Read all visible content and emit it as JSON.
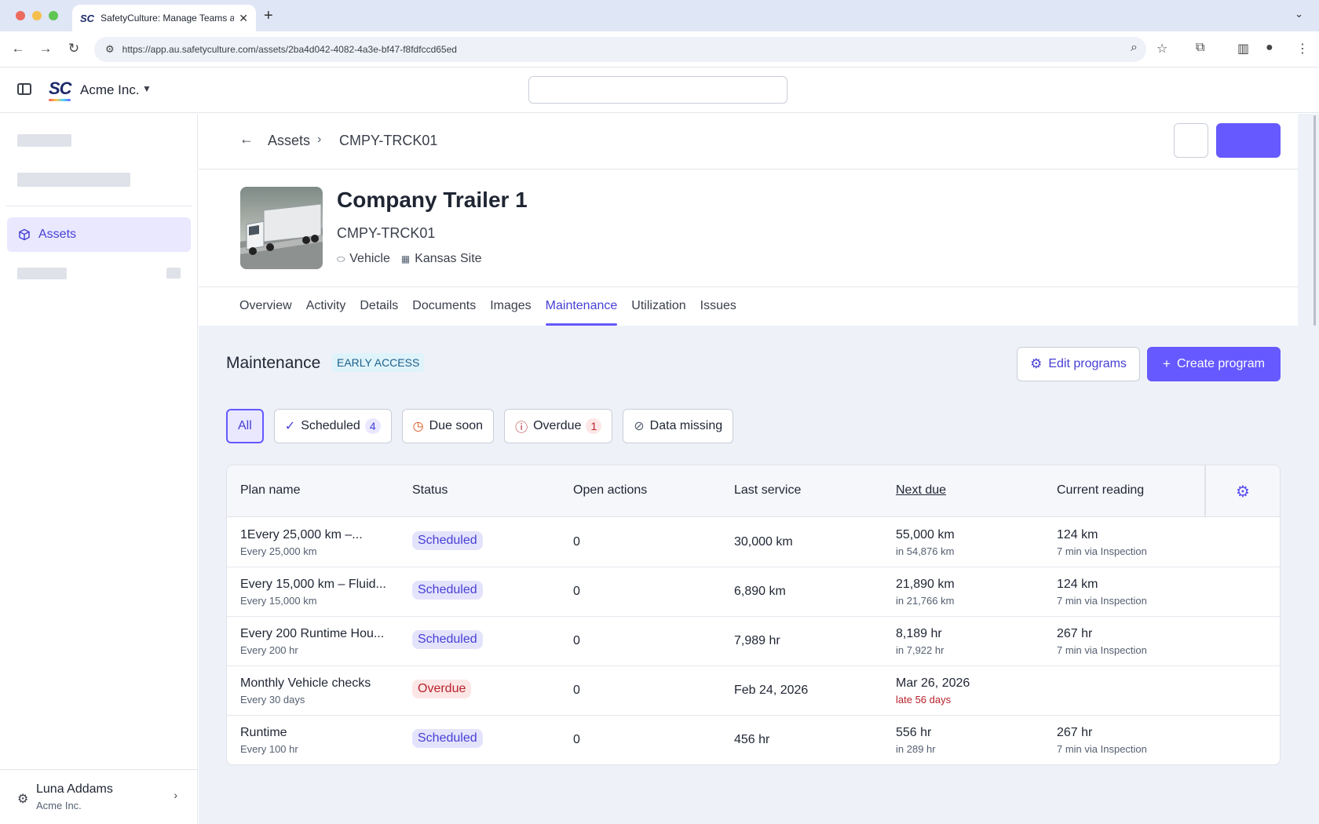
{
  "browser": {
    "tab_title": "SafetyCulture: Manage Teams and...",
    "tab_favicon": "SC",
    "new_tab": "+",
    "url": "https://app.au.safetyculture.com/assets/2ba4d042-4082-4a3e-bf47-f8fdfccd65ed"
  },
  "header": {
    "logo": "SC",
    "org_name": "Acme Inc."
  },
  "sidebar": {
    "active_item": "Assets",
    "user_name": "Luna Addams",
    "user_org": "Acme Inc."
  },
  "breadcrumb": {
    "parent": "Assets",
    "current": "CMPY-TRCK01"
  },
  "asset": {
    "title": "Company Trailer 1",
    "code": "CMPY-TRCK01",
    "type": "Vehicle",
    "site": "Kansas Site"
  },
  "tabs": [
    {
      "label": "Overview"
    },
    {
      "label": "Activity"
    },
    {
      "label": "Details"
    },
    {
      "label": "Documents"
    },
    {
      "label": "Images"
    },
    {
      "label": "Maintenance"
    },
    {
      "label": "Utilization"
    },
    {
      "label": "Issues"
    }
  ],
  "maintenance": {
    "title": "Maintenance",
    "badge": "EARLY ACCESS",
    "edit_label": "Edit programs",
    "create_label": "Create program"
  },
  "filters": {
    "all": "All",
    "scheduled": "Scheduled",
    "scheduled_count": "4",
    "due_soon": "Due soon",
    "overdue": "Overdue",
    "overdue_count": "1",
    "data_missing": "Data missing"
  },
  "table": {
    "headers": {
      "plan": "Plan name",
      "status": "Status",
      "open_actions": "Open actions",
      "last_service": "Last service",
      "next_due": "Next due",
      "current_reading": "Current reading"
    },
    "rows": [
      {
        "plan": "1Every 25,000 km –...",
        "plan_sub": "Every 25,000 km",
        "status": "Scheduled",
        "open_actions": "0",
        "last_service": "30,000 km",
        "next_due": "55,000 km",
        "next_due_sub": "in 54,876 km",
        "reading": "124 km",
        "reading_sub": "7 min via Inspection"
      },
      {
        "plan": "Every 15,000 km – Fluid...",
        "plan_sub": "Every 15,000 km",
        "status": "Scheduled",
        "open_actions": "0",
        "last_service": "6,890 km",
        "next_due": "21,890 km",
        "next_due_sub": "in 21,766 km",
        "reading": "124 km",
        "reading_sub": "7 min via Inspection"
      },
      {
        "plan": "Every 200 Runtime Hou...",
        "plan_sub": "Every 200 hr",
        "status": "Scheduled",
        "open_actions": "0",
        "last_service": "7,989 hr",
        "next_due": "8,189 hr",
        "next_due_sub": "in 7,922 hr",
        "reading": "267 hr",
        "reading_sub": "7 min via Inspection"
      },
      {
        "plan": "Monthly Vehicle checks",
        "plan_sub": "Every 30 days",
        "status": "Overdue",
        "open_actions": "0",
        "last_service": "Feb 24, 2026",
        "next_due": "Mar 26, 2026",
        "next_due_sub": "late 56 days",
        "reading": "",
        "reading_sub": ""
      },
      {
        "plan": "Runtime",
        "plan_sub": "Every 100 hr",
        "status": "Scheduled",
        "open_actions": "0",
        "last_service": "456 hr",
        "next_due": "556 hr",
        "next_due_sub": "in 289 hr",
        "reading": "267 hr",
        "reading_sub": "7 min via Inspection"
      }
    ]
  },
  "colors": {
    "accent": "#6559ff",
    "accent_text": "#4740d4",
    "overdue": "#b8232b",
    "page_bg": "#eef1f8"
  }
}
